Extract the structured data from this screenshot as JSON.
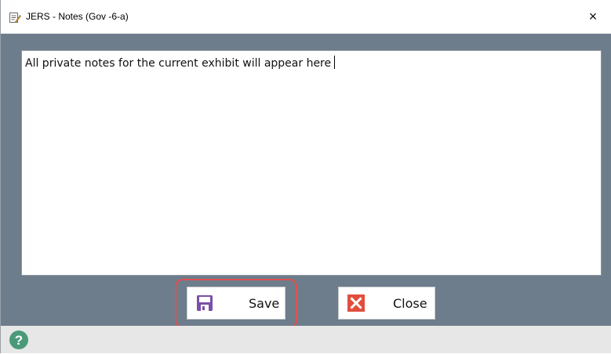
{
  "window": {
    "title": "JERS - Notes  (Gov -6-a)",
    "close_glyph": "×",
    "icon": "notes-app-icon"
  },
  "notes": {
    "text": "All private notes for the current exhibit will appear here"
  },
  "buttons": {
    "save_label": "Save",
    "save_icon": "floppy-disk-icon",
    "close_label": "Close",
    "close_icon": "red-x-icon"
  },
  "statusbar": {
    "help_icon": "help-icon",
    "help_glyph": "?"
  },
  "colors": {
    "panel_bg": "#6e7d8c",
    "highlight_ring": "#e0514e",
    "save_icon": "#7b4fa8",
    "close_icon": "#e24e3b",
    "help_icon": "#4a9a7a"
  }
}
